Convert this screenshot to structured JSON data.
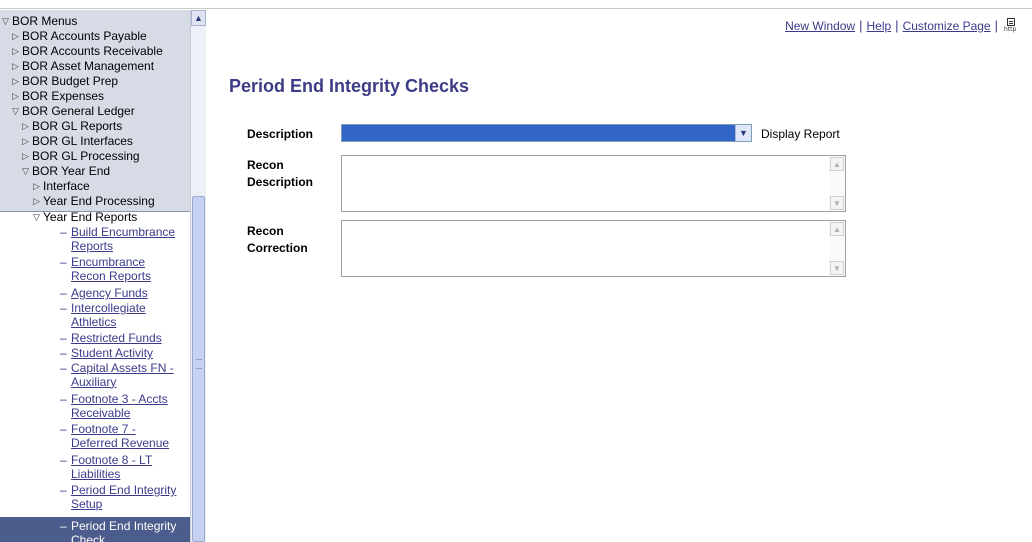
{
  "nav": {
    "root": "BOR Menus",
    "items": [
      "BOR Accounts Payable",
      "BOR Accounts Receivable",
      "BOR Asset Management",
      "BOR Budget Prep",
      "BOR Expenses",
      "BOR General Ledger",
      "BOR GL Reports",
      "BOR GL Interfaces",
      "BOR GL Processing",
      "BOR Year End",
      "Interface",
      "Year End Processing",
      "Year End Reports"
    ],
    "links": [
      {
        "line1": "Build Encumbrance",
        "line2": "Reports"
      },
      {
        "line1": "Encumbrance",
        "line2": "Recon Reports"
      },
      {
        "line1": "Agency Funds",
        "line2": ""
      },
      {
        "line1": "Intercollegiate",
        "line2": "Athletics"
      },
      {
        "line1": "Restricted Funds",
        "line2": ""
      },
      {
        "line1": "Student Activity",
        "line2": ""
      },
      {
        "line1": "Capital Assets FN -",
        "line2": "Auxiliary"
      },
      {
        "line1": "Footnote 3 - Accts",
        "line2": "Receivable"
      },
      {
        "line1": "Footnote 7 -",
        "line2": "Deferred Revenue"
      },
      {
        "line1": "Footnote 8 - LT",
        "line2": "Liabilities"
      },
      {
        "line1": "Period End Integrity",
        "line2": "Setup"
      }
    ],
    "selected": {
      "line1": "Period End Integrity",
      "line2": "Check"
    }
  },
  "toplinks": {
    "new_window": "New Window",
    "help": "Help",
    "customize": "Customize Page",
    "separator": "|",
    "http_label": "http"
  },
  "page": {
    "title": "Period End Integrity Checks"
  },
  "form": {
    "description_label": "Description",
    "description_value": "",
    "display_report": "Display Report",
    "recon_desc_label_1": "Recon",
    "recon_desc_label_2": "Description",
    "recon_correction_label_1": "Recon",
    "recon_correction_label_2": "Correction"
  },
  "colors": {
    "link": "#3b3b8c",
    "title": "#3c3c86",
    "nav_shade": "#d6dbe6",
    "selected_bg": "#4c5c8c",
    "select_highlight": "#3166c6"
  }
}
